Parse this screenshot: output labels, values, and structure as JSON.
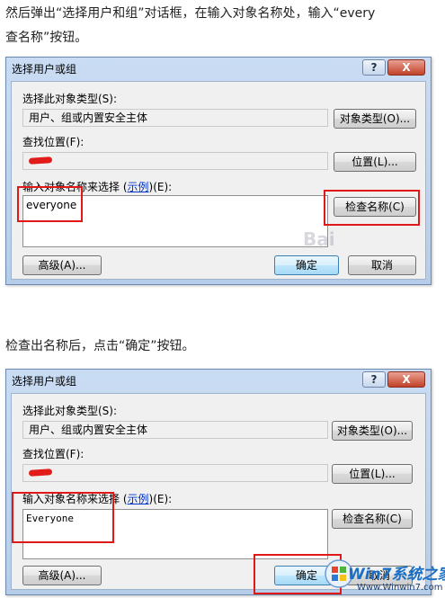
{
  "article": {
    "line1": "然后弹出“选择用户和组”对话框，在输入对象名称处，输入“every",
    "line1b": "查名称”按钮。",
    "line2": "检查出名称后，点击“确定”按钮。"
  },
  "dialog1": {
    "title": "选择用户或组",
    "help": "?",
    "close": "X",
    "object_type_label": "选择此对象类型(S):",
    "object_type_value": "用户、组或内置安全主体",
    "object_type_button": "对象类型(O)...",
    "location_label": "查找位置(F):",
    "location_button": "位置(L)...",
    "name_label": "输入对象名称来选择 (",
    "name_link": "示例",
    "name_label_end": ")(E):",
    "name_value": "everyone",
    "check_button": "检查名称(C)",
    "advanced_button": "高级(A)...",
    "ok_button": "确定",
    "cancel_button": "取消"
  },
  "dialog2": {
    "title": "选择用户或组",
    "help": "?",
    "close": "X",
    "object_type_label": "选择此对象类型(S):",
    "object_type_value": "用户、组或内置安全主体",
    "object_type_button": "对象类型(O)...",
    "location_label": "查找位置(F):",
    "location_button": "位置(L)...",
    "name_label": "输入对象名称来选择 (",
    "name_link": "示例",
    "name_label_end": ")(E):",
    "name_value": "Everyone",
    "check_button": "检查名称(C)",
    "advanced_button": "高级(A)...",
    "ok_button": "确定",
    "cancel_button": "取消"
  },
  "watermark": {
    "brand": "Win7系统之家",
    "url": "Www.Winwin7.com",
    "baidu": "Bai"
  },
  "colors": {
    "highlight": "#e11818",
    "title_bar": "#b6cde9",
    "close_button": "#c2422a"
  }
}
